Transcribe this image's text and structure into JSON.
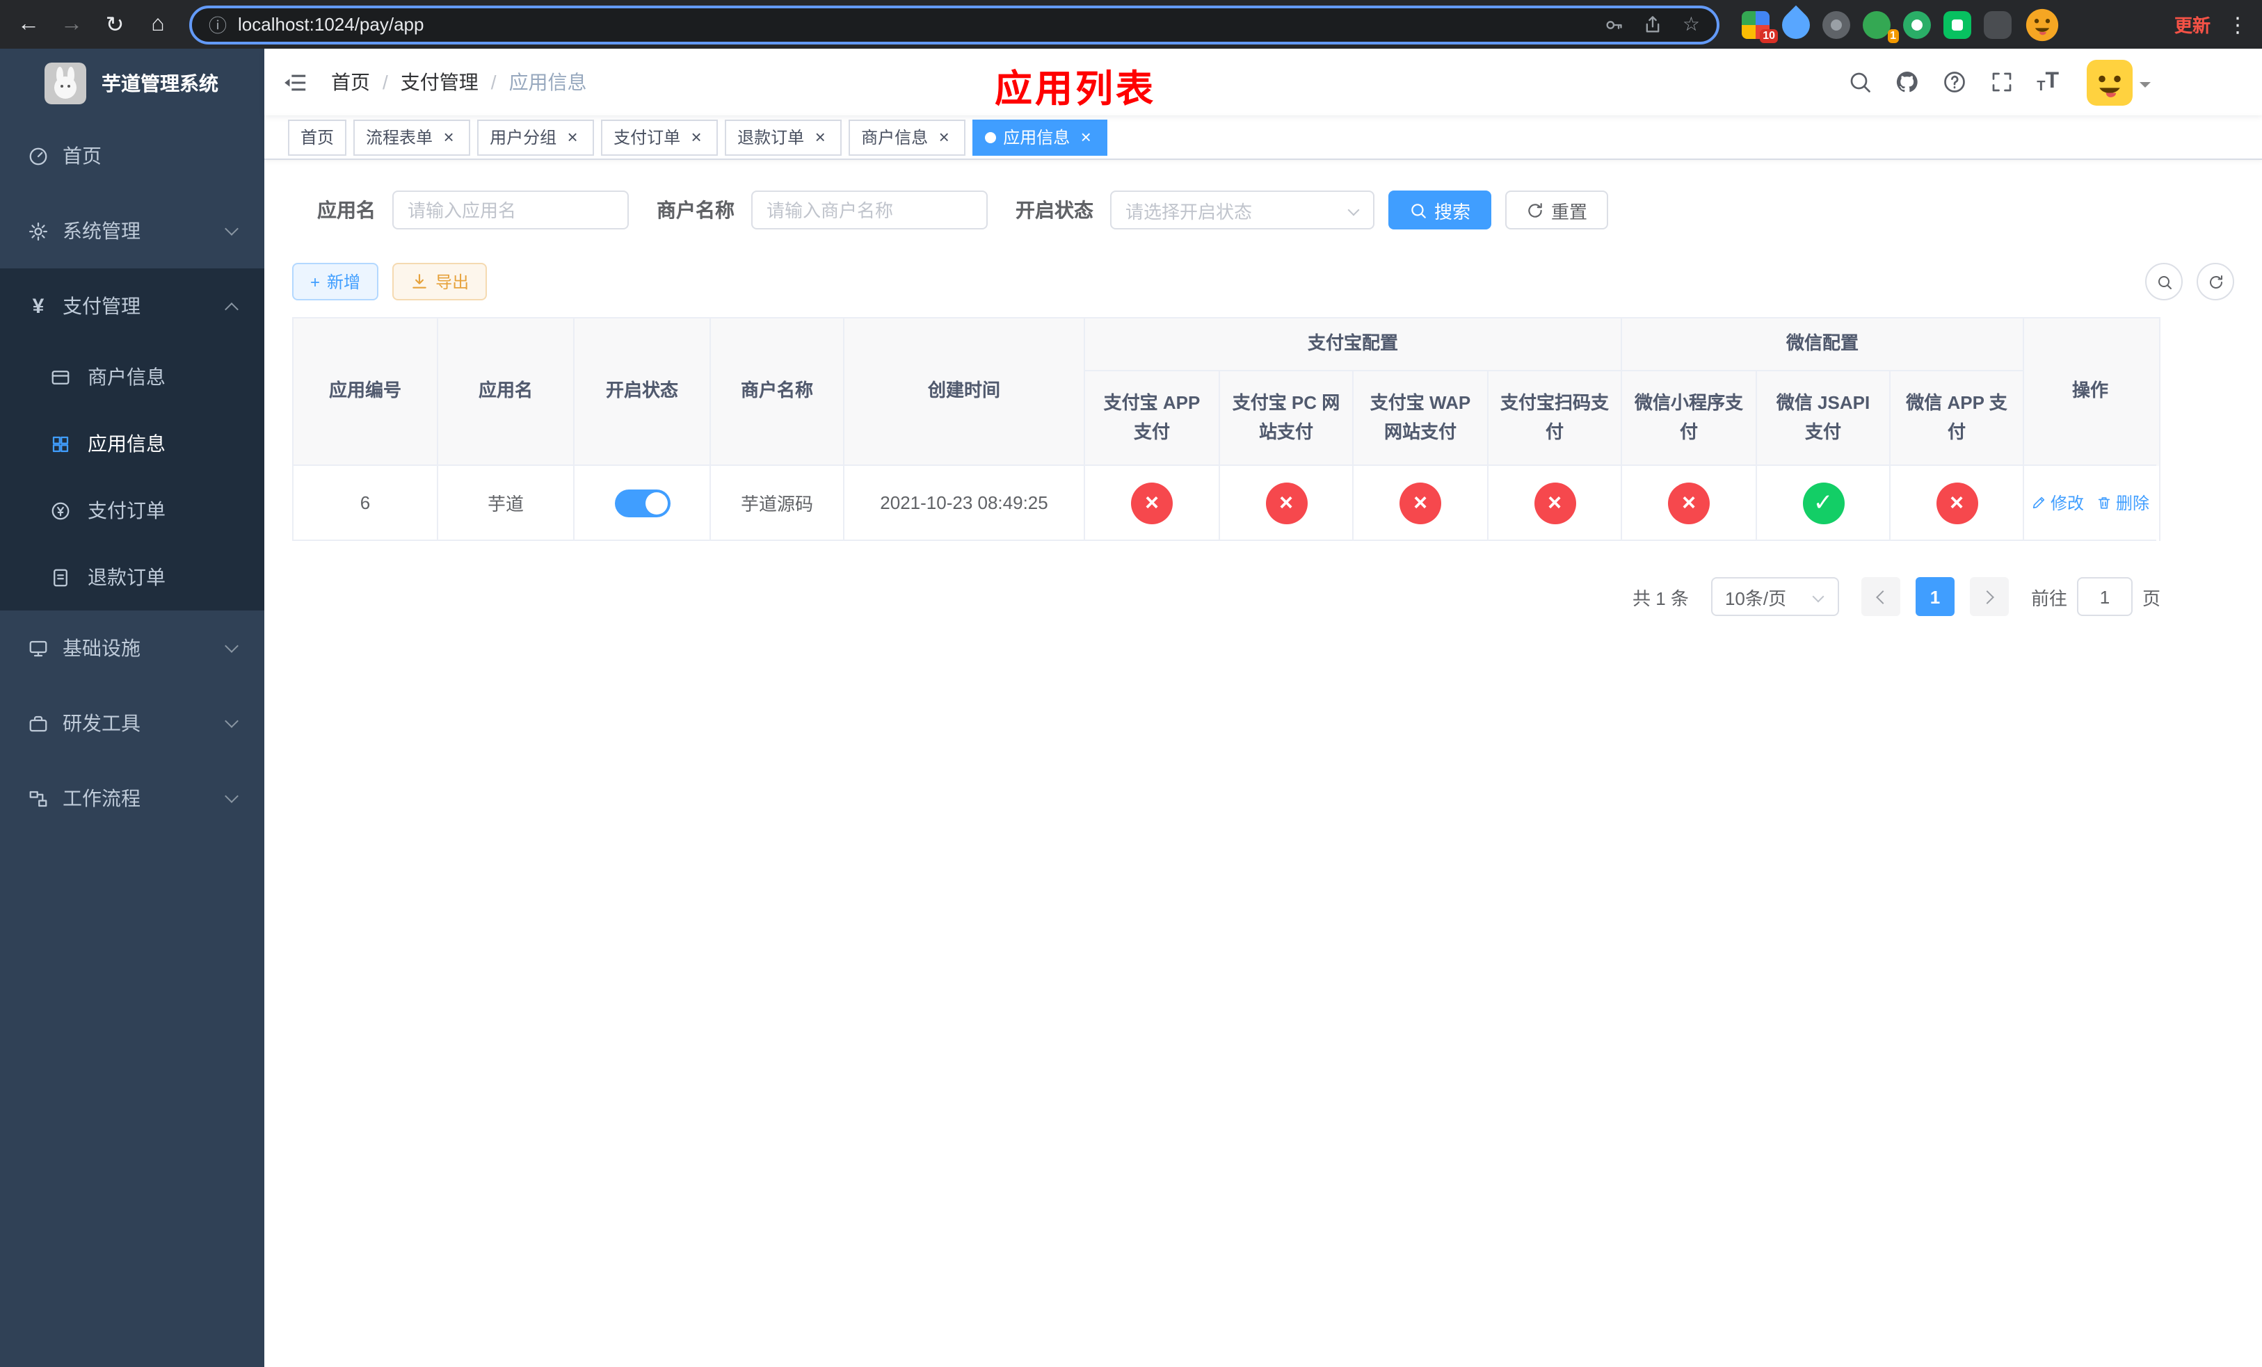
{
  "colors": {
    "accent": "#409eff",
    "danger": "#f6484d",
    "success": "#13ce66",
    "warning": "#e6a23c",
    "page_title_red": "#ff0000",
    "sidebar_bg": "#304156",
    "sidebar_submenu_bg": "#1f2d3d"
  },
  "icons": {
    "back": "←",
    "forward": "→",
    "reload": "↻",
    "home": "⌂",
    "info": "ⓘ",
    "star": "☆",
    "more": "⋮",
    "close": "×",
    "check": "✓",
    "cross": "×",
    "plus": "+",
    "yen": "¥",
    "font_size_large": "T",
    "font_size_small": "T"
  },
  "browser": {
    "url": "localhost:1024/pay/app",
    "update_label": "更新",
    "ext_badge_10": "10",
    "ext_badge_1": "1"
  },
  "sidebar": {
    "title": "芋道管理系统",
    "items": {
      "home": "首页",
      "system": "系统管理",
      "payment": "支付管理",
      "merchant_info": "商户信息",
      "app_info": "应用信息",
      "pay_order": "支付订单",
      "refund_order": "退款订单",
      "infra": "基础设施",
      "devtools": "研发工具",
      "workflow": "工作流程"
    }
  },
  "header": {
    "breadcrumb": [
      "首页",
      "支付管理",
      "应用信息"
    ],
    "separator": "/",
    "page_title": "应用列表"
  },
  "tabs": [
    {
      "label": "首页"
    },
    {
      "label": "流程表单"
    },
    {
      "label": "用户分组"
    },
    {
      "label": "支付订单"
    },
    {
      "label": "退款订单"
    },
    {
      "label": "商户信息"
    },
    {
      "label": "应用信息"
    }
  ],
  "filters": {
    "app_name_label": "应用名",
    "app_name_placeholder": "请输入应用名",
    "merchant_label": "商户名称",
    "merchant_placeholder": "请输入商户名称",
    "status_label": "开启状态",
    "status_placeholder": "请选择开启状态",
    "search_label": "搜索",
    "reset_label": "重置"
  },
  "toolbar": {
    "add_label": "新增",
    "export_label": "导出"
  },
  "table": {
    "alipay_group": "支付宝配置",
    "wechat_group": "微信配置",
    "columns": {
      "app_id": "应用编号",
      "app_name": "应用名",
      "status": "开启状态",
      "merchant": "商户名称",
      "created": "创建时间",
      "alipay_app": "支付宝 APP 支付",
      "alipay_pc": "支付宝 PC 网站支付",
      "alipay_wap": "支付宝 WAP 网站支付",
      "alipay_scan": "支付宝扫码支付",
      "wx_mini": "微信小程序支付",
      "wx_jsapi": "微信 JSAPI 支付",
      "wx_app": "微信 APP 支付",
      "actions": "操作"
    },
    "row": {
      "app_id": "6",
      "app_name": "芋道",
      "enabled": true,
      "merchant": "芋道源码",
      "created": "2021-10-23 08:49:25",
      "alipay_app": false,
      "alipay_pc": false,
      "alipay_wap": false,
      "alipay_scan": false,
      "wx_mini": false,
      "wx_jsapi": true,
      "wx_app": false
    },
    "edit_label": "修改",
    "delete_label": "删除"
  },
  "pagination": {
    "total": "共 1 条",
    "page_size": "10条/页",
    "page": "1",
    "goto_prefix": "前往",
    "goto_value": "1",
    "goto_suffix": "页"
  }
}
